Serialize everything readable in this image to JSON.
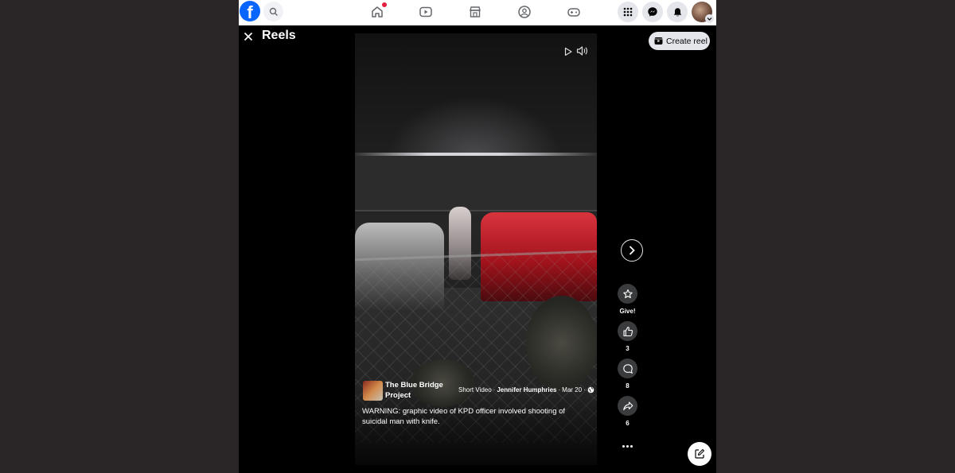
{
  "colors": {
    "brand": "#0866ff",
    "page_bg": "#2a2627",
    "notification": "#e41e3f"
  },
  "brand_letter": "f",
  "nav": {
    "icons": [
      "search-icon",
      "home-icon",
      "video-icon",
      "marketplace-icon",
      "groups-icon",
      "gaming-icon",
      "menu-grid-icon",
      "messenger-icon",
      "notifications-icon",
      "account-avatar"
    ]
  },
  "reels": {
    "title": "Reels",
    "create_label": "Create reel"
  },
  "post": {
    "page_name": "The Blue Bridge Project",
    "type": "Short Video",
    "author": "Jennifer Humphries",
    "date": "Mar 20",
    "sep1": "·",
    "sep2": "·",
    "sep3": "·",
    "caption": "WARNING: graphic video of KPD  officer involved shooting of suicidal man with knife."
  },
  "actions": {
    "give_label": "Give!",
    "like_count": "3",
    "comment_count": "8",
    "share_count": "6"
  }
}
